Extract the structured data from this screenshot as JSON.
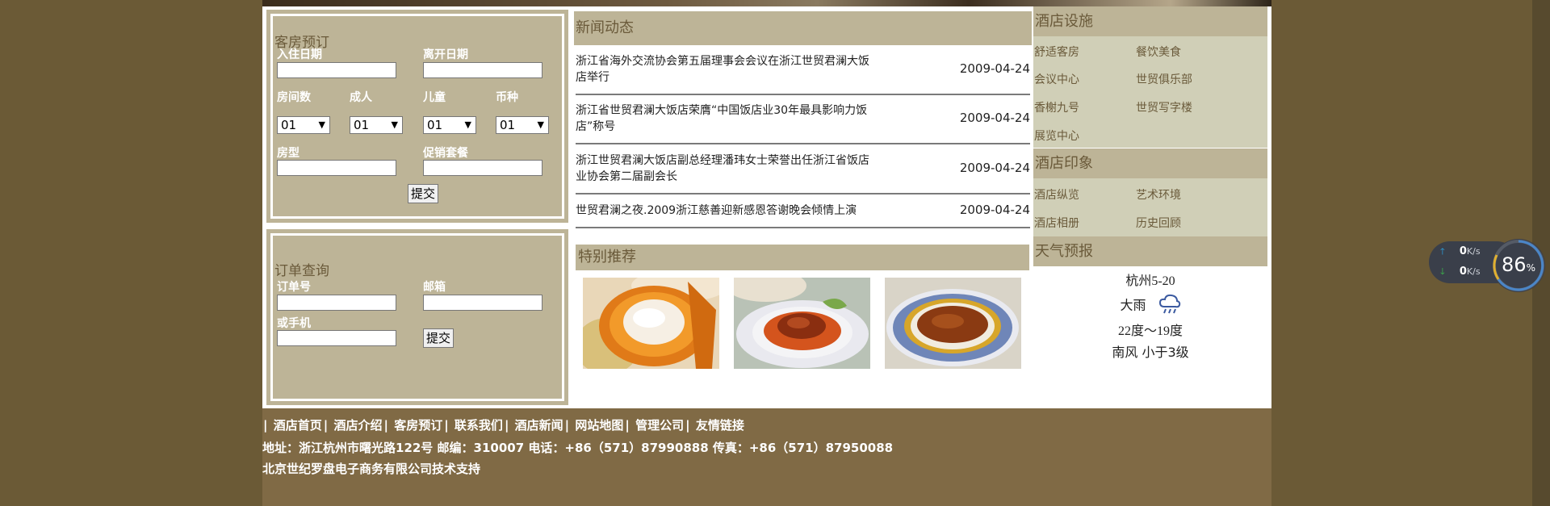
{
  "footer": {
    "links": [
      "酒店首页",
      "酒店介绍",
      "客房预订",
      "联系我们",
      "酒店新闻",
      "网站地图",
      "管理公司",
      "友情链接"
    ],
    "separator": "|",
    "address": "地址：浙江杭州市曙光路122号 邮编：310007 电话：+86（571）87990888 传真：+86（571）87950088",
    "support": "北京世纪罗盘电子商务有限公司技术支持"
  },
  "booking": {
    "title": "客房预订",
    "checkin_label": "入住日期",
    "checkout_label": "离开日期",
    "rooms_label": "房间数",
    "adults_label": "成人",
    "children_label": "儿童",
    "currency_label": "币种",
    "rooms_value": "01",
    "adults_value": "01",
    "children_value": "01",
    "currency_value": "01",
    "roomtype_label": "房型",
    "promo_label": "促销套餐",
    "submit_label": "提交"
  },
  "order": {
    "title": "订单查询",
    "order_no_label": "订单号",
    "email_label": "邮箱",
    "phone_label": "或手机",
    "submit_label": "提交"
  },
  "news": {
    "title": "新闻动态",
    "items": [
      {
        "title": "浙江省海外交流协会第五届理事会会议在浙江世贸君澜大饭店举行",
        "date": "2009-04-24"
      },
      {
        "title": "浙江省世贸君澜大饭店荣膺“中国饭店业30年最具影响力饭店”称号",
        "date": "2009-04-24"
      },
      {
        "title": "浙江世贸君澜大饭店副总经理潘玮女士荣誉出任浙江省饭店业协会第二届副会长",
        "date": "2009-04-24"
      },
      {
        "title": "世贸君澜之夜.2009浙江慈善迎新感恩答谢晚会倾情上演",
        "date": "2009-04-24"
      }
    ]
  },
  "recommend": {
    "title": "特别推荐"
  },
  "facilities": {
    "title": "酒店设施",
    "items": [
      "舒适客房",
      "餐饮美食",
      "会议中心",
      "世贸俱乐部",
      "香榭九号",
      "世贸写字楼",
      "展览中心"
    ]
  },
  "impression": {
    "title": "酒店印象",
    "items": [
      "酒店纵览",
      "艺术环境",
      "酒店相册",
      "历史回顾"
    ]
  },
  "weather": {
    "title": "天气预报",
    "city": "杭州5-20",
    "condition": "大雨",
    "temperature": "22度～19度",
    "wind": "南风  小于3级",
    "icon": "rain-cloud-icon"
  },
  "netspeed": {
    "up": "0",
    "down": "0",
    "unit": "K/s",
    "percent": "86",
    "percent_sign": "%"
  }
}
